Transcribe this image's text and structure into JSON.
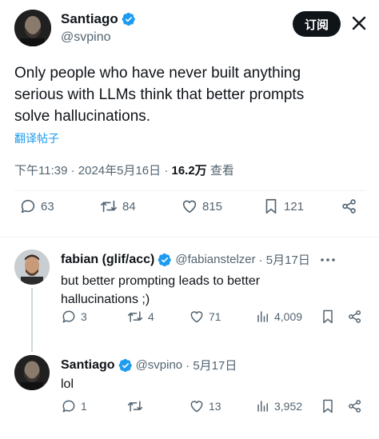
{
  "main_tweet": {
    "author_name": "Santiago",
    "author_handle": "@svpino",
    "follow_label": "订阅",
    "text_line1": "Only people who have never built anything",
    "text_line2": "serious with LLMs think that better prompts",
    "text_line3": "solve hallucinations.",
    "translate_label": "翻译帖子",
    "timestamp": "下午11:39 · 2024年5月16日 · ",
    "views_count": "16.2万",
    "views_label": " 查看",
    "replies": "63",
    "retweets": "84",
    "likes": "815",
    "bookmarks": "121"
  },
  "reply1": {
    "author_name": "fabian (glif/acc)",
    "author_handle": "@fabianstelzer",
    "date": "· 5月17日",
    "text_line1": "but better prompting leads to better",
    "text_line2": "hallucinations ;)",
    "replies": "3",
    "retweets": "4",
    "likes": "71",
    "views": "4,009"
  },
  "reply2": {
    "author_name": "Santiago",
    "author_handle": "@svpino",
    "date": "· 5月17日",
    "text": "lol",
    "replies": "1",
    "retweets": "",
    "likes": "13",
    "views": "3,952"
  },
  "colors": {
    "verified_blue": "#1d9bf0",
    "text_primary": "#0f1419",
    "text_secondary": "#536471",
    "link": "#1d9bf0"
  },
  "icons": [
    "verified-icon",
    "reply-icon",
    "retweet-icon",
    "like-icon",
    "bookmark-icon",
    "share-icon",
    "views-icon"
  ]
}
